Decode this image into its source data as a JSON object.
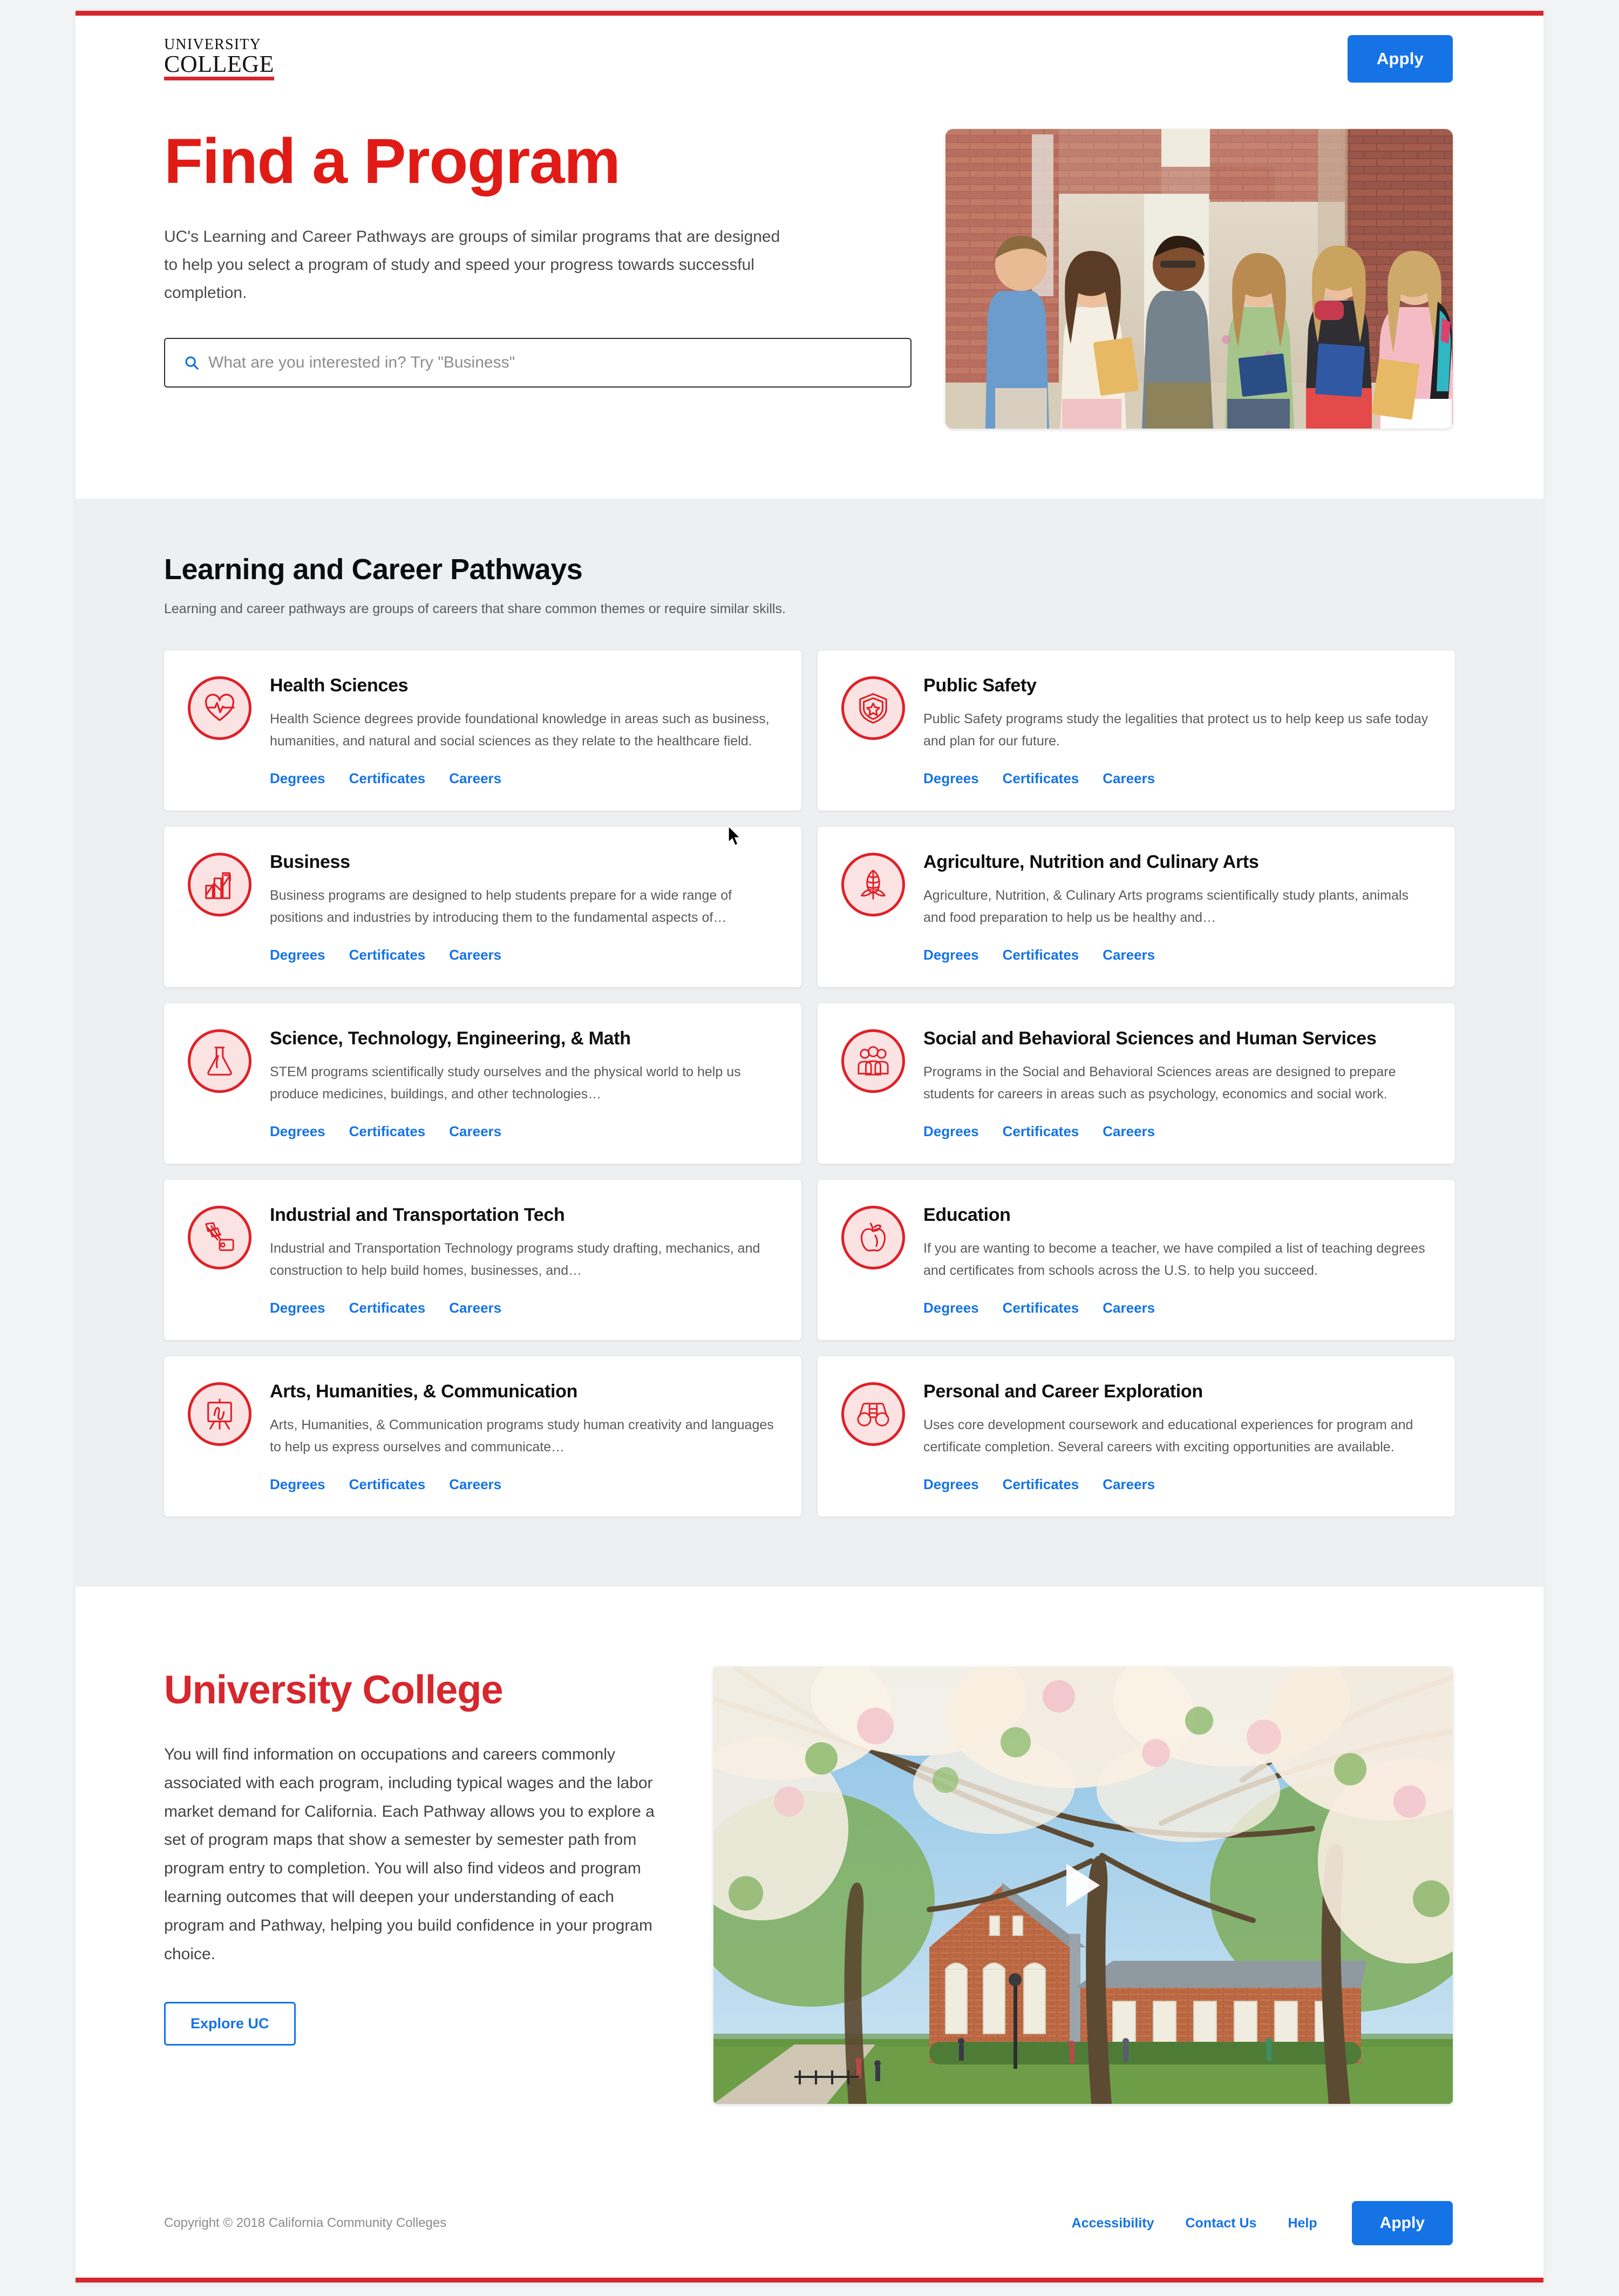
{
  "header": {
    "logo_line1": "UNIVERSITY",
    "logo_line2": "COLLEGE",
    "apply_label": "Apply"
  },
  "hero": {
    "title": "Find a Program",
    "paragraph": "UC's Learning and Career Pathways are groups of similar programs that are designed to help you select a program of study and speed your progress towards successful completion.",
    "search_placeholder": "What are you interested in? Try \"Business\"",
    "search_value": "",
    "image_alt": "Six college students standing in a brick hallway holding books"
  },
  "pathways": {
    "title": "Learning and Career Pathways",
    "subtitle": "Learning and career pathways are groups of careers that share common themes or require similar skills.",
    "link_labels": [
      "Degrees",
      "Certificates",
      "Careers"
    ],
    "cards": [
      {
        "icon": "heartbeat-icon",
        "title": "Health Sciences",
        "description": "Health Science degrees provide foundational knowledge in areas such as business, humanities, and natural and social sciences as they relate to the healthcare field.",
        "links": [
          "Degrees",
          "Certificates",
          "Careers"
        ]
      },
      {
        "icon": "shield-star-icon",
        "title": "Public Safety",
        "description": "Public Safety programs study the legalities that protect us to help keep us safe today and plan for our future.",
        "links": [
          "Degrees",
          "Certificates",
          "Careers"
        ]
      },
      {
        "icon": "bar-chart-icon",
        "title": "Business",
        "description": "Business programs are designed to help students prepare for a wide range of positions and industries by introducing them to the fundamental aspects of…",
        "links": [
          "Degrees",
          "Certificates",
          "Careers"
        ]
      },
      {
        "icon": "corn-icon",
        "title": "Agriculture, Nutrition and Culinary Arts",
        "description": "Agriculture, Nutrition, & Culinary Arts programs scientifically study plants, animals and food preparation to help us be healthy and…",
        "links": [
          "Degrees",
          "Certificates",
          "Careers"
        ]
      },
      {
        "icon": "flask-icon",
        "title": "Science, Technology, Engineering, & Math",
        "description": "STEM programs scientifically study ourselves and the physical world to help us produce medicines, buildings, and other technologies…",
        "links": [
          "Degrees",
          "Certificates",
          "Careers"
        ]
      },
      {
        "icon": "people-group-icon",
        "title": "Social and Behavioral Sciences and Human Services",
        "description": "Programs in the Social and Behavioral Sciences areas are designed to prepare students for careers in areas such as psychology, economics and social work.",
        "links": [
          "Degrees",
          "Certificates",
          "Careers"
        ]
      },
      {
        "icon": "excavator-icon",
        "title": "Industrial and Transportation Tech",
        "description": "Industrial and Transportation Technology programs study drafting, mechanics, and construction to help build homes, businesses, and…",
        "links": [
          "Degrees",
          "Certificates",
          "Careers"
        ]
      },
      {
        "icon": "apple-icon",
        "title": "Education",
        "description": "If you are wanting to become a teacher, we have compiled a list of teaching degrees and certificates from schools across the U.S. to help you succeed.",
        "links": [
          "Degrees",
          "Certificates",
          "Careers"
        ]
      },
      {
        "icon": "easel-icon",
        "title": "Arts, Humanities, & Communication",
        "description": "Arts, Humanities, & Communication programs study human creativity and languages to help us express ourselves and communicate…",
        "links": [
          "Degrees",
          "Certificates",
          "Careers"
        ]
      },
      {
        "icon": "binoculars-icon",
        "title": "Personal and Career Exploration",
        "description": "Uses core development coursework and educational experiences for program and certificate completion. Several careers with exciting opportunities are available.",
        "links": [
          "Degrees",
          "Certificates",
          "Careers"
        ]
      }
    ]
  },
  "about": {
    "title": "University College",
    "paragraph": "You will find information on occupations and careers commonly associated with each program, including typical wages and the labor market demand for California. Each Pathway allows you to explore a set of program maps that show a semester by semester path from program entry to completion. You will also find videos and program learning outcomes that will deepen your understanding of each program and Pathway, helping you build confidence in your program choice.",
    "button_label": "Explore UC",
    "video_alt": "Campus brick building framed by blossoming cherry trees"
  },
  "footer": {
    "copyright": "Copyright © 2018 California Community Colleges",
    "links": [
      "Accessibility",
      "Contact Us",
      "Help"
    ],
    "apply_label": "Apply"
  },
  "colors": {
    "brand_red": "#d6272d",
    "hero_red": "#e01b15",
    "link_blue": "#1573e6",
    "section_gray": "#eeeff1",
    "page_gray": "#f2f3f5"
  }
}
